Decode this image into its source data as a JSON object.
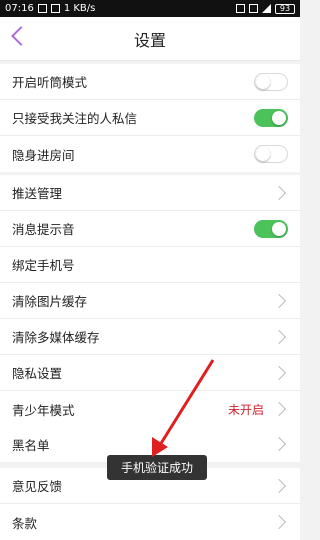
{
  "status_bar": {
    "time": "07:16",
    "speed": "1 KB/s",
    "battery": "93"
  },
  "header": {
    "title": "设置"
  },
  "group1": [
    {
      "label": "开启听筒模式",
      "type": "toggle",
      "on": false
    },
    {
      "label": "只接受我关注的人私信",
      "type": "toggle",
      "on": true
    },
    {
      "label": "隐身进房间",
      "type": "toggle",
      "on": false
    }
  ],
  "group2": [
    {
      "label": "推送管理",
      "type": "chevron"
    },
    {
      "label": "消息提示音",
      "type": "toggle",
      "on": true
    },
    {
      "label": "绑定手机号",
      "type": "none"
    },
    {
      "label": "清除图片缓存",
      "type": "chevron"
    },
    {
      "label": "清除多媒体缓存",
      "type": "chevron"
    },
    {
      "label": "隐私设置",
      "type": "chevron"
    },
    {
      "label": "青少年模式",
      "type": "chevron",
      "status": "未开启"
    }
  ],
  "group3": [
    {
      "label": "黑名单",
      "type": "chevron"
    }
  ],
  "group4": [
    {
      "label": "意见反馈",
      "type": "chevron"
    },
    {
      "label": "条款",
      "type": "chevron"
    }
  ],
  "toast": "手机验证成功",
  "colors": {
    "accent": "#b06cdb",
    "toggle_on": "#4cc25a",
    "status_red": "#d0232e",
    "annotation_arrow": "#e02020"
  }
}
